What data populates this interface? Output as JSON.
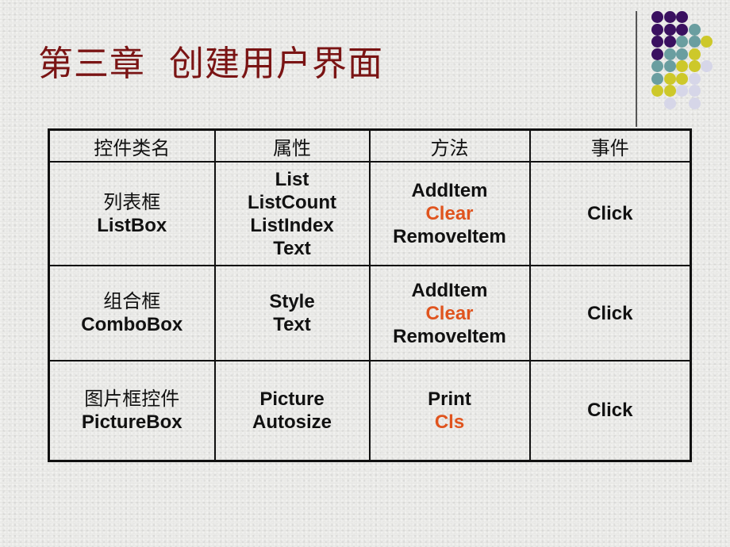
{
  "slide": {
    "title": "第三章  创建用户界面",
    "title_color": "#7a1414",
    "accent_colors": {
      "purple": "#3a1060",
      "teal": "#6a9ea0",
      "yellow": "#cdc82a",
      "lavender": "#d6d6e8"
    }
  },
  "decoration": {
    "dot_grid": [
      [
        "purple",
        "purple",
        "purple",
        null,
        null
      ],
      [
        "purple",
        "purple",
        "purple",
        "teal",
        null
      ],
      [
        "purple",
        "purple",
        "teal",
        "teal",
        "yellow"
      ],
      [
        "purple",
        "teal",
        "teal",
        "yellow",
        null
      ],
      [
        "teal",
        "teal",
        "yellow",
        "yellow",
        "lavender"
      ],
      [
        "teal",
        "yellow",
        "yellow",
        "lavender",
        null
      ],
      [
        "yellow",
        "yellow",
        "lavender",
        "lavender",
        null
      ],
      [
        null,
        "lavender",
        null,
        "lavender",
        null
      ]
    ]
  },
  "table": {
    "headers": [
      "控件类名",
      "属性",
      "方法",
      "事件"
    ],
    "rows": [
      {
        "control_cn": "列表框",
        "control_en": "ListBox",
        "properties": [
          "List",
          "ListCount",
          "ListIndex",
          "Text"
        ],
        "methods": [
          {
            "text": "AddItem",
            "highlight": false
          },
          {
            "text": "Clear",
            "highlight": true
          },
          {
            "text": "RemoveItem",
            "highlight": false
          }
        ],
        "events": [
          "Click"
        ]
      },
      {
        "control_cn": "组合框",
        "control_en": "ComboBox",
        "properties": [
          "Style",
          "Text"
        ],
        "methods": [
          {
            "text": "AddItem",
            "highlight": false
          },
          {
            "text": "Clear",
            "highlight": true
          },
          {
            "text": "RemoveItem",
            "highlight": false
          }
        ],
        "events": [
          "Click"
        ]
      },
      {
        "control_cn": "图片框控件",
        "control_en": "PictureBox",
        "properties": [
          "Picture",
          "Autosize"
        ],
        "methods": [
          {
            "text": "Print",
            "highlight": false
          },
          {
            "text": "Cls",
            "highlight": true
          }
        ],
        "events": [
          "Click"
        ]
      }
    ],
    "highlight_color": "#e0541e"
  }
}
